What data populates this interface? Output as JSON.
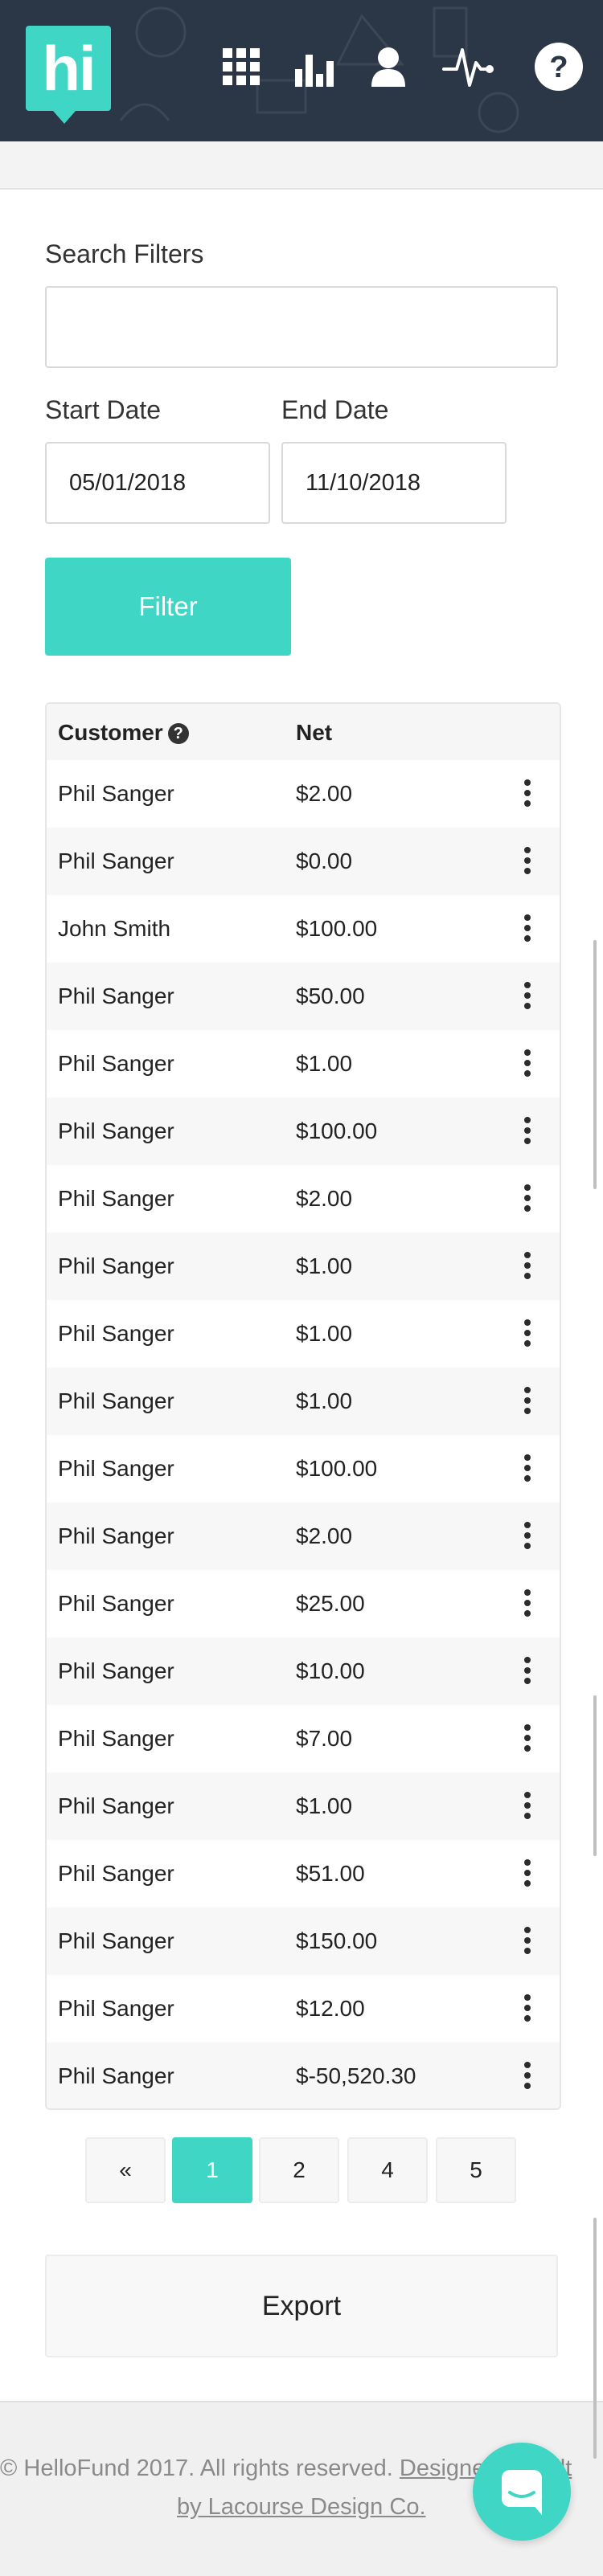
{
  "header": {
    "logo_text": "hi",
    "nav_icons": [
      "apps-grid-icon",
      "bar-chart-icon",
      "user-icon",
      "activity-pulse-icon",
      "help-icon"
    ]
  },
  "filters": {
    "search_label": "Search Filters",
    "search_value": "",
    "start_label": "Start Date",
    "start_value": "05/01/2018",
    "end_label": "End Date",
    "end_value": "11/10/2018",
    "filter_button": "Filter"
  },
  "table": {
    "columns": [
      "Customer",
      "Net"
    ],
    "rows": [
      {
        "customer": "Phil Sanger",
        "net": "$2.00"
      },
      {
        "customer": "Phil Sanger",
        "net": "$0.00"
      },
      {
        "customer": "John Smith",
        "net": "$100.00"
      },
      {
        "customer": "Phil Sanger",
        "net": "$50.00"
      },
      {
        "customer": "Phil Sanger",
        "net": "$1.00"
      },
      {
        "customer": "Phil Sanger",
        "net": "$100.00"
      },
      {
        "customer": "Phil Sanger",
        "net": "$2.00"
      },
      {
        "customer": "Phil Sanger",
        "net": "$1.00"
      },
      {
        "customer": "Phil Sanger",
        "net": "$1.00"
      },
      {
        "customer": "Phil Sanger",
        "net": "$1.00"
      },
      {
        "customer": "Phil Sanger",
        "net": "$100.00"
      },
      {
        "customer": "Phil Sanger",
        "net": "$2.00"
      },
      {
        "customer": "Phil Sanger",
        "net": "$25.00"
      },
      {
        "customer": "Phil Sanger",
        "net": "$10.00"
      },
      {
        "customer": "Phil Sanger",
        "net": "$7.00"
      },
      {
        "customer": "Phil Sanger",
        "net": "$1.00"
      },
      {
        "customer": "Phil Sanger",
        "net": "$51.00"
      },
      {
        "customer": "Phil Sanger",
        "net": "$150.00"
      },
      {
        "customer": "Phil Sanger",
        "net": "$12.00"
      },
      {
        "customer": "Phil Sanger",
        "net": "$-50,520.30"
      }
    ]
  },
  "pagination": {
    "prev": "«",
    "pages": [
      "1",
      "2",
      "4",
      "5"
    ],
    "active": "1"
  },
  "export_button": "Export",
  "footer": {
    "copyright": "© HelloFund 2017. All rights reserved.",
    "design_link": "Designed & Built",
    "design_link_line2": "by Lacourse Design Co."
  },
  "colors": {
    "accent": "#3fd6c6",
    "header_bg": "#2b3646"
  }
}
